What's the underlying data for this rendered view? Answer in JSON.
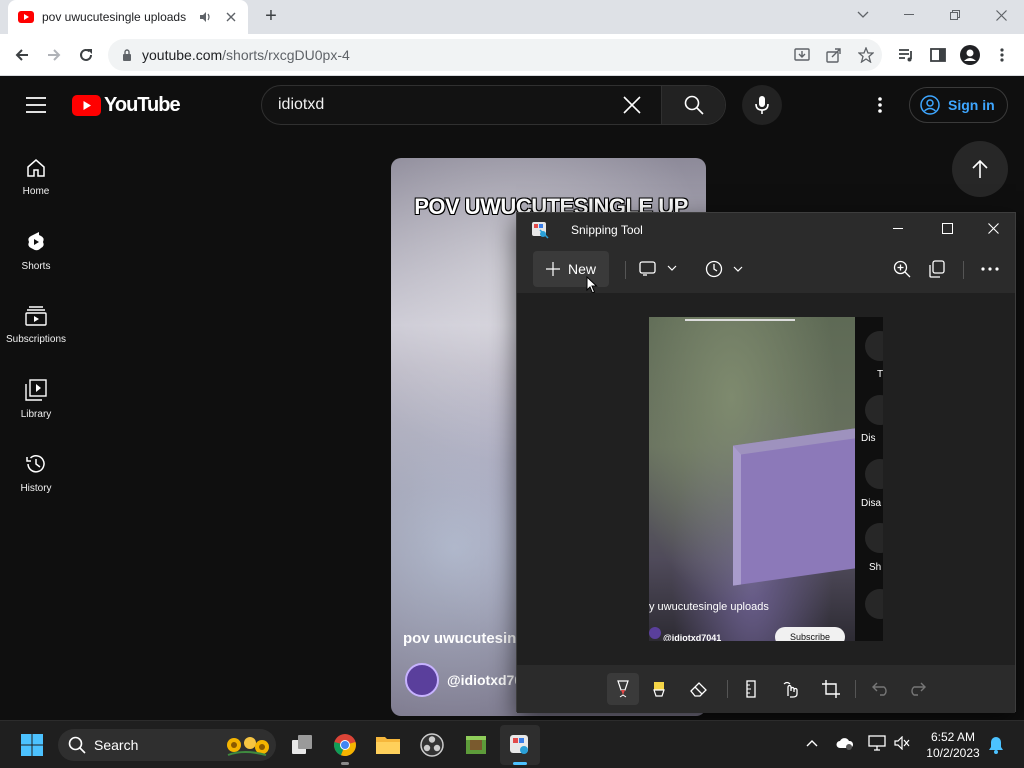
{
  "browser": {
    "tab_title": "pov uwucutesingle uploads",
    "new_tab_label": "+",
    "url_domain": "youtube.com",
    "url_path": "/shorts/rxcgDU0px-4"
  },
  "youtube": {
    "logo_text": "YouTube",
    "search_query": "idiotxd",
    "sign_in_label": "Sign in",
    "nav": [
      {
        "label": "Home",
        "icon": "home-icon"
      },
      {
        "label": "Shorts",
        "icon": "shorts-icon"
      },
      {
        "label": "Subscriptions",
        "icon": "subscriptions-icon"
      },
      {
        "label": "Library",
        "icon": "library-icon"
      },
      {
        "label": "History",
        "icon": "history-icon"
      }
    ],
    "short": {
      "overlay_title": "POV UWUCUTESINGLE UP",
      "caption": "pov uwucutesing",
      "channel": "@idiotxd70"
    }
  },
  "snipping_tool": {
    "title": "Snipping Tool",
    "new_label": "New",
    "screenshot": {
      "caption": "y uwucutesingle uploads",
      "channel": "@idiotxd7041",
      "subscribe_label": "Subscribe",
      "action_labels": [
        "T",
        "Dis",
        "Disa",
        "Sh"
      ]
    }
  },
  "taskbar": {
    "search_label": "Search",
    "time": "6:52 AM",
    "date": "10/2/2023"
  },
  "colors": {
    "youtube_red": "#ff0000",
    "link_blue": "#3ea6ff",
    "taskbar_bg": "#1f1f1f"
  }
}
